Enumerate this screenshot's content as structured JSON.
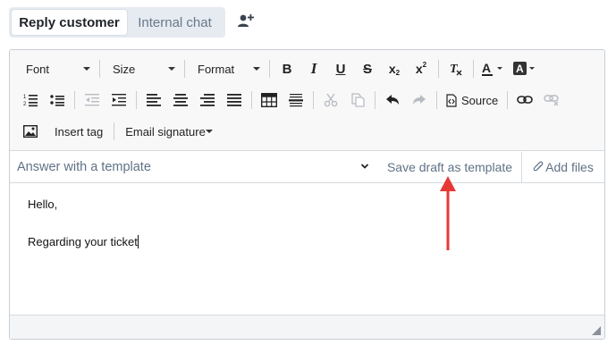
{
  "tabs": [
    {
      "label": "Reply customer",
      "active": true
    },
    {
      "label": "Internal chat",
      "active": false
    }
  ],
  "toolbar": {
    "font": "Font",
    "size": "Size",
    "format": "Format",
    "source_label": "Source",
    "insert_tag_label": "Insert tag",
    "email_signature": "Email signature"
  },
  "template_bar": {
    "placeholder": "Answer with a template",
    "save_draft_label": "Save draft as template",
    "add_files_label": "Add files"
  },
  "body": {
    "line1": "Hello,",
    "line2": "",
    "line3": "Regarding your ticket"
  },
  "colors": {
    "accent_muted": "#5f7286",
    "annotation_arrow": "#e53935",
    "tab_bg": "#e6ebf1"
  }
}
